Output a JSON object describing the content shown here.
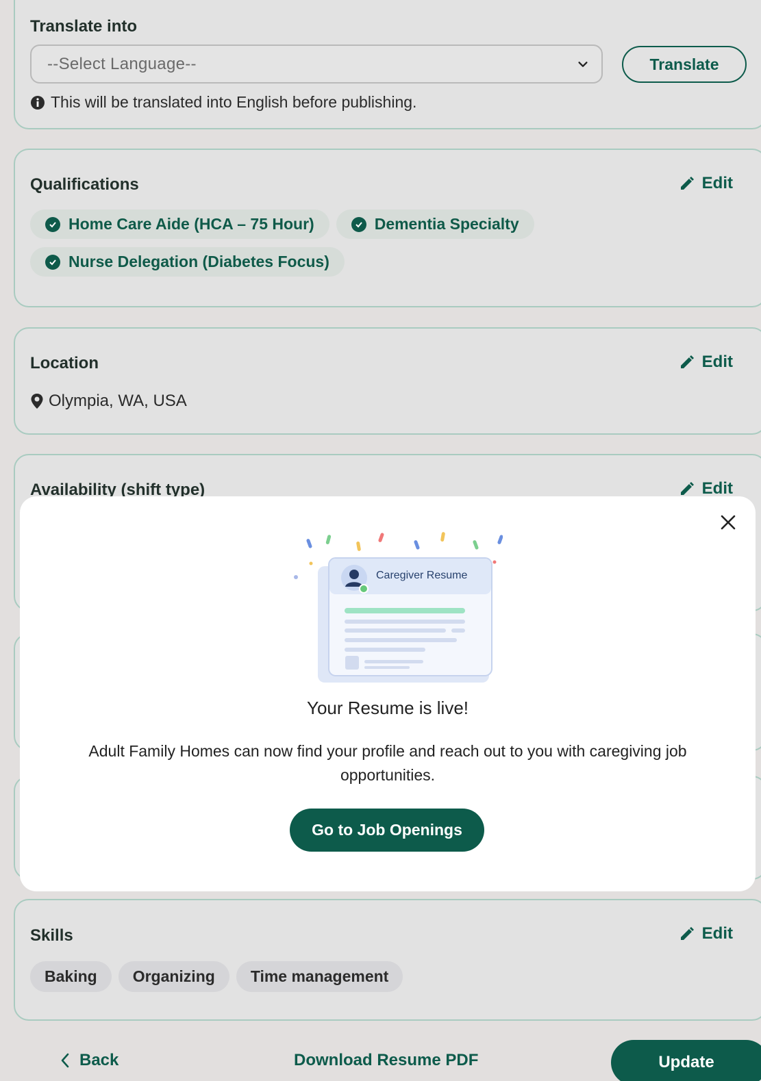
{
  "translate": {
    "label": "Translate into",
    "select_value": "--Select Language--",
    "button": "Translate",
    "note": "This will be translated into English before publishing."
  },
  "qualifications": {
    "title": "Qualifications",
    "edit": "Edit",
    "items": [
      "Home Care Aide (HCA – 75 Hour)",
      "Dementia Specialty",
      "Nurse Delegation (Diabetes Focus)"
    ]
  },
  "location": {
    "title": "Location",
    "edit": "Edit",
    "value": "Olympia, WA, USA"
  },
  "availability": {
    "title": "Availability (shift type)",
    "edit": "Edit"
  },
  "modal": {
    "illustration_title": "Caregiver Resume",
    "title": "Your Resume is live!",
    "text": "Adult Family Homes can now find your profile and reach out to you with caregiving job opportunities.",
    "cta": "Go to Job Openings"
  },
  "skills": {
    "title": "Skills",
    "edit": "Edit",
    "items": [
      "Baking",
      "Organizing",
      "Time management"
    ]
  },
  "footer": {
    "back": "Back",
    "download": "Download Resume PDF",
    "update": "Update"
  },
  "colors": {
    "primary": "#0d5b4b",
    "card_border": "#a9cbc0",
    "background": "#e2dfde"
  }
}
